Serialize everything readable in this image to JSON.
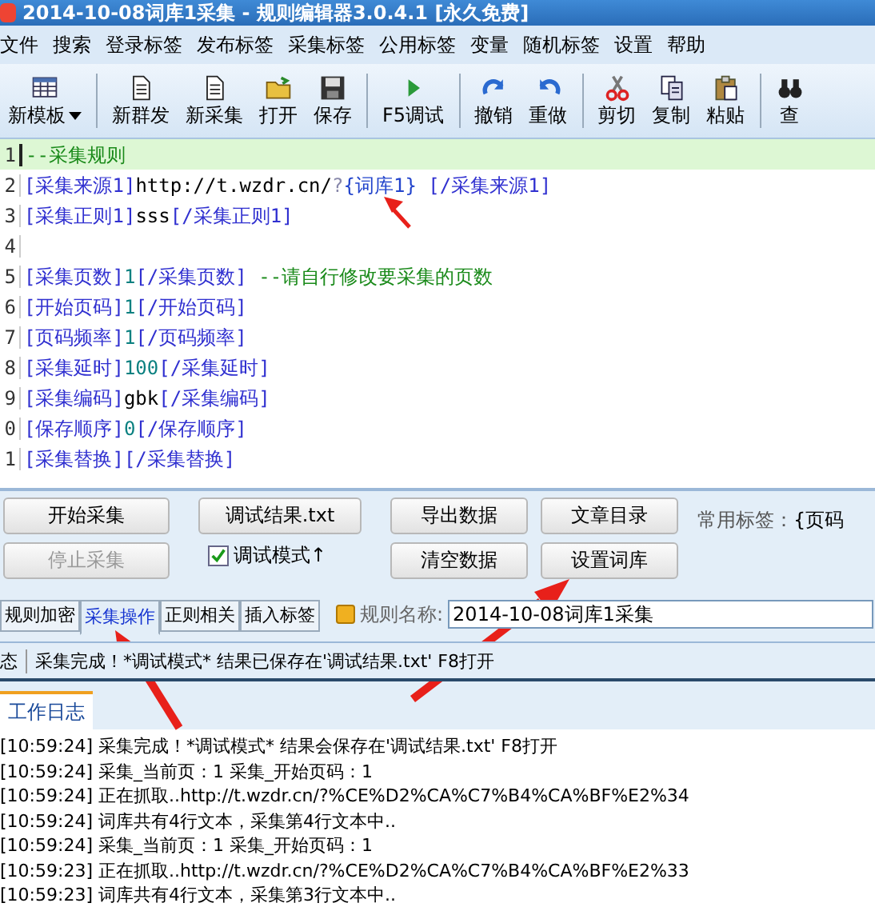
{
  "window": {
    "title": "2014-10-08词库1采集 - 规则编辑器3.0.4.1 [永久免费]"
  },
  "menu": [
    "文件",
    "搜索",
    "登录标签",
    "发布标签",
    "采集标签",
    "公用标签",
    "变量",
    "随机标签",
    "设置",
    "帮助"
  ],
  "toolbar": [
    [
      {
        "label": "新模板",
        "dropdown": true
      }
    ],
    [
      {
        "label": "新群发",
        "dropdown": false
      },
      {
        "label": "新采集",
        "dropdown": false
      },
      {
        "label": "打开",
        "dropdown": false
      },
      {
        "label": "保存",
        "dropdown": false
      }
    ],
    [
      {
        "label": "F5调试",
        "dropdown": false
      }
    ],
    [
      {
        "label": "撤销",
        "dropdown": false
      },
      {
        "label": "重做",
        "dropdown": false
      }
    ],
    [
      {
        "label": "剪切",
        "dropdown": false
      },
      {
        "label": "复制",
        "dropdown": false
      },
      {
        "label": "粘贴",
        "dropdown": false
      }
    ],
    [
      {
        "label": "查",
        "dropdown": false
      }
    ]
  ],
  "editor": {
    "lines": [
      {
        "number": "1",
        "selected": true,
        "segments": [
          {
            "kind": "comment",
            "text": "--采集规则"
          }
        ]
      },
      {
        "number": "2",
        "selected": false,
        "segments": [
          {
            "kind": "tag",
            "text": "[采集来源1]"
          },
          {
            "kind": "text",
            "text": "http://t.wzdr.cn/"
          },
          {
            "kind": "faint",
            "text": "?"
          },
          {
            "kind": "var",
            "text": "{词库1}"
          },
          {
            "kind": "tag",
            "text": " [/采集来源1]"
          }
        ]
      },
      {
        "number": "3",
        "selected": false,
        "segments": [
          {
            "kind": "tag",
            "text": "[采集正则1]"
          },
          {
            "kind": "text",
            "text": "sss"
          },
          {
            "kind": "tag",
            "text": "[/采集正则1]"
          }
        ]
      },
      {
        "number": "4",
        "selected": false
      },
      {
        "number": "5",
        "selected": false,
        "segments": [
          {
            "kind": "tag",
            "text": "[采集页数]"
          },
          {
            "kind": "number",
            "text": "1"
          },
          {
            "kind": "tag",
            "text": "[/采集页数]"
          },
          {
            "kind": "comment",
            "text": " --请自行修改要采集的页数"
          }
        ]
      },
      {
        "number": "6",
        "selected": false,
        "segments": [
          {
            "kind": "tag",
            "text": "[开始页码]"
          },
          {
            "kind": "number",
            "text": "1"
          },
          {
            "kind": "tag",
            "text": "[/开始页码]"
          }
        ]
      },
      {
        "number": "7",
        "selected": false,
        "segments": [
          {
            "kind": "tag",
            "text": "[页码频率]"
          },
          {
            "kind": "number",
            "text": "1"
          },
          {
            "kind": "tag",
            "text": "[/页码频率]"
          }
        ]
      },
      {
        "number": "8",
        "selected": false,
        "segments": [
          {
            "kind": "tag",
            "text": "[采集延时]"
          },
          {
            "kind": "number",
            "text": "100"
          },
          {
            "kind": "tag",
            "text": "[/采集延时]"
          }
        ]
      },
      {
        "number": "9",
        "selected": false,
        "segments": [
          {
            "kind": "tag",
            "text": "[采集编码]"
          },
          {
            "kind": "text",
            "text": "gbk"
          },
          {
            "kind": "tag",
            "text": "[/采集编码]"
          }
        ]
      },
      {
        "number": "0",
        "selected": false,
        "segments": [
          {
            "kind": "tag",
            "text": "[保存顺序]"
          },
          {
            "kind": "number",
            "text": "0"
          },
          {
            "kind": "tag",
            "text": "[/保存顺序]"
          }
        ]
      },
      {
        "number": "1",
        "selected": false,
        "segments": [
          {
            "kind": "tag",
            "text": "[采集替换]"
          },
          {
            "kind": "tag",
            "text": "[/采集替换]"
          }
        ]
      }
    ]
  },
  "buttons": [
    {
      "label": "开始采集",
      "disabled": false
    },
    {
      "label": "停止采集",
      "disabled": true
    },
    {
      "label": "调试结果.txt",
      "disabled": false
    },
    {
      "label": "导出数据",
      "disabled": false
    },
    {
      "label": "清空数据",
      "disabled": false
    },
    {
      "label": "文章目录",
      "disabled": false
    },
    {
      "label": "设置词库",
      "disabled": false
    }
  ],
  "debug_checkbox": {
    "label": "调试模式↑",
    "checked": true
  },
  "common_tags": {
    "label": "常用标签：",
    "value": "{页码"
  },
  "tabs": [
    {
      "label": "规则加密",
      "selected": false
    },
    {
      "label": "采集操作",
      "selected": true
    },
    {
      "label": "正则相关",
      "selected": false
    },
    {
      "label": "插入标签",
      "selected": false
    }
  ],
  "rule_name": {
    "label": "规则名称:",
    "value": "2014-10-08词库1采集"
  },
  "status_bar": {
    "label": "态",
    "message": "采集完成！*调试模式* 结果已保存在'调试结果.txt' F8打开"
  },
  "log": {
    "tab": "工作日志",
    "lines": [
      "[10:59:24] 采集完成！*调试模式* 结果会保存在'调试结果.txt' F8打开",
      "[10:59:24] 采集_当前页：1 采集_开始页码：1",
      "[10:59:24] 正在抓取..http://t.wzdr.cn/?%CE%D2%CA%C7%B4%CA%BF%E2%34",
      "[10:59:24] 词库共有4行文本，采集第4行文本中..",
      "[10:59:24] 采集_当前页：1 采集_开始页码：1",
      "[10:59:23] 正在抓取..http://t.wzdr.cn/?%CE%D2%CA%C7%B4%CA%BF%E2%33",
      "[10:59:23] 词库共有4行文本，采集第3行文本中.."
    ]
  }
}
